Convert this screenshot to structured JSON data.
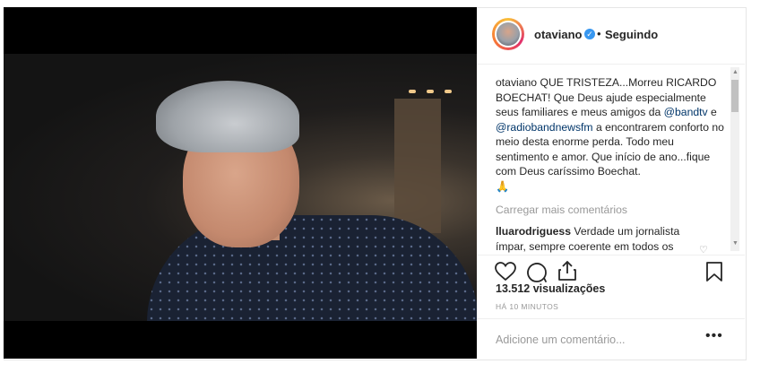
{
  "post": {
    "username": "otaviano",
    "separator": "•",
    "following_label": "Seguindo",
    "caption": {
      "username": "otaviano",
      "text_1": "QUE TRISTEZA...Morreu RICARDO BOECHAT! Que Deus ajude especialmente seus familiares e meus amigos da ",
      "mention_1": "@bandtv",
      "text_2": " e ",
      "mention_2": "@radiobandnewsfm",
      "text_3": " a encontrarem conforto no meio desta enorme perda. Todo meu sentimento e amor. Que início de ano...fique com Deus caríssimo Boechat.",
      "emoji": "🙏"
    },
    "load_more_label": "Carregar mais comentários",
    "comment": {
      "username": "lluarodriguess",
      "text": "Verdade um jornalista ímpar, sempre coerente em todos os"
    },
    "views": "13.512 visualizações",
    "timestamp": "HÁ 10 MINUTOS",
    "add_comment_placeholder": "Adicione um comentário...",
    "more_options": "•••"
  },
  "colors": {
    "link": "#003569",
    "verified": "#3897f0",
    "muted": "#999999",
    "text": "#262626"
  },
  "icons": [
    "verified-badge-icon",
    "like-heart-icon",
    "comment-icon",
    "share-icon",
    "save-bookmark-icon",
    "more-options-icon",
    "small-heart-icon"
  ]
}
